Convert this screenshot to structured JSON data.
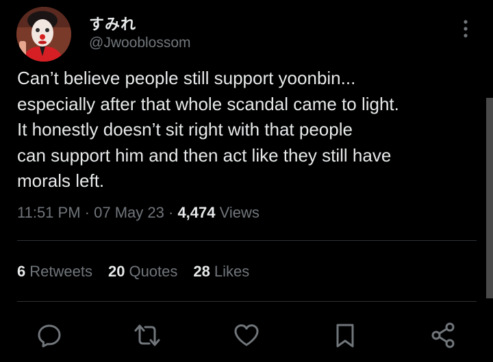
{
  "author": {
    "display_name": "すみれ",
    "handle": "@Jwooblossom"
  },
  "tweet": {
    "text": "Can’t believe people still support yoonbin...\nespecially after that whole scandal came to light.\nIt honestly doesn’t sit right with that people\ncan support him and then act like they still have\nmorals left.",
    "time": "11:51 PM",
    "date": "07 May 23",
    "views_count": "4,474",
    "views_label": "Views",
    "separator": "·"
  },
  "stats": {
    "retweets_count": "6",
    "retweets_label": "Retweets",
    "quotes_count": "20",
    "quotes_label": "Quotes",
    "likes_count": "28",
    "likes_label": "Likes"
  },
  "icons": {
    "more": "more-vertical-icon",
    "reply": "reply-icon",
    "retweet": "retweet-icon",
    "like": "heart-icon",
    "bookmark": "bookmark-icon",
    "share": "share-icon"
  },
  "colors": {
    "background": "#000000",
    "text_primary": "#e7e9ea",
    "text_secondary": "#71767b",
    "divider": "#2f3336"
  }
}
